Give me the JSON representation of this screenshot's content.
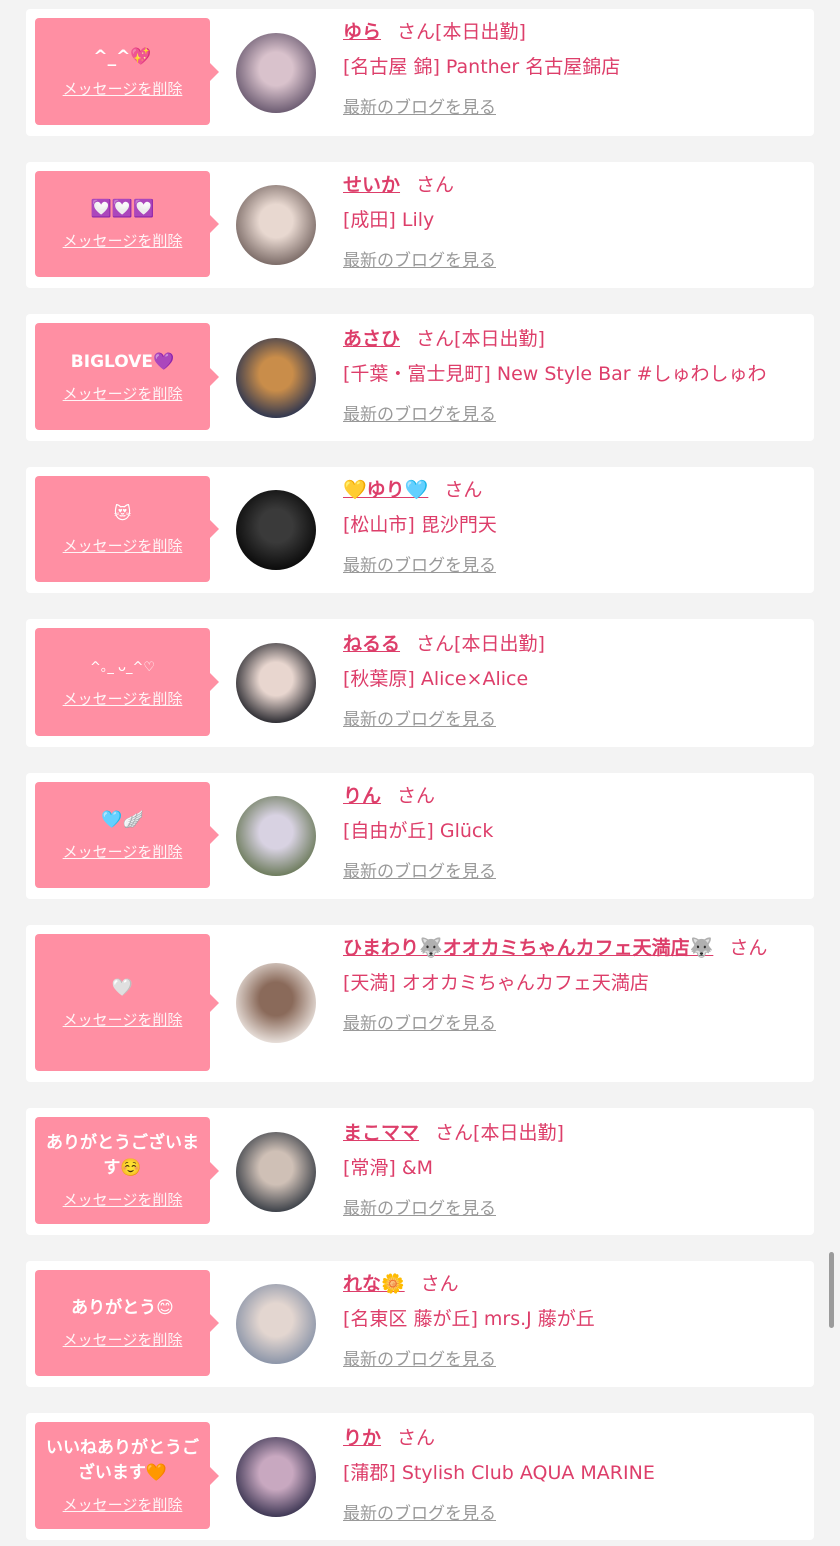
{
  "delete_label": "メッセージを削除",
  "blog_label": "最新のブログを見る",
  "san_suffix": "さん",
  "cards": [
    {
      "message": "^_^💖",
      "name": "ゆら",
      "status": "[本日出勤]",
      "shop": "[名古屋 錦] Panther 名古屋錦店",
      "avatar_colors": [
        "#6a5a70",
        "#d9c2cc"
      ]
    },
    {
      "message": "💟💟💟",
      "name": "せいか",
      "status": "",
      "shop": "[成田] Lily",
      "avatar_colors": [
        "#7a6a66",
        "#e8d8d0"
      ]
    },
    {
      "message": "BIGLOVE💜",
      "name": "あさひ",
      "status": "[本日出勤]",
      "shop": "[千葉・富士見町] New Style Bar #しゅわしゅわ",
      "avatar_colors": [
        "#2d3550",
        "#c98d4a"
      ]
    },
    {
      "message": "😻",
      "name": "💛ゆり🩵",
      "status": "",
      "shop": "[松山市] 毘沙門天",
      "avatar_colors": [
        "#0a0a0a",
        "#3a3a3a"
      ]
    },
    {
      "message": "^｡_ ᴗ_^♡",
      "name": "ねるる",
      "status": "[本日出勤]",
      "shop": "[秋葉原] Alice×Alice",
      "avatar_colors": [
        "#2a2a30",
        "#e8d6cf"
      ]
    },
    {
      "message": "🩵🪽",
      "name": "りん",
      "status": "",
      "shop": "[自由が丘] Glück",
      "avatar_colors": [
        "#6b7a5a",
        "#d8d2e2"
      ]
    },
    {
      "message": "🤍",
      "name": "ひまわり🐺オオカミちゃんカフェ天満店🐺",
      "status": "",
      "shop": "[天満] オオカミちゃんカフェ天満店",
      "avatar_colors": [
        "#e9e1dc",
        "#8a6a5a"
      ]
    },
    {
      "message": "ありがとうございます☺️",
      "name": "まこママ",
      "status": "[本日出勤]",
      "shop": "[常滑] &M",
      "avatar_colors": [
        "#3a3f47",
        "#cfc0b6"
      ]
    },
    {
      "message": "ありがとう😊",
      "name": "れな🌼",
      "status": "",
      "shop": "[名東区 藤が丘] mrs.J 藤が丘",
      "avatar_colors": [
        "#8a94a8",
        "#e3d6d0"
      ]
    },
    {
      "message": "いいねありがとうございます🧡",
      "name": "りか",
      "status": "",
      "shop": "[蒲郡] Stylish Club AQUA MARINE",
      "avatar_colors": [
        "#3b3552",
        "#c8a8c0"
      ]
    }
  ]
}
